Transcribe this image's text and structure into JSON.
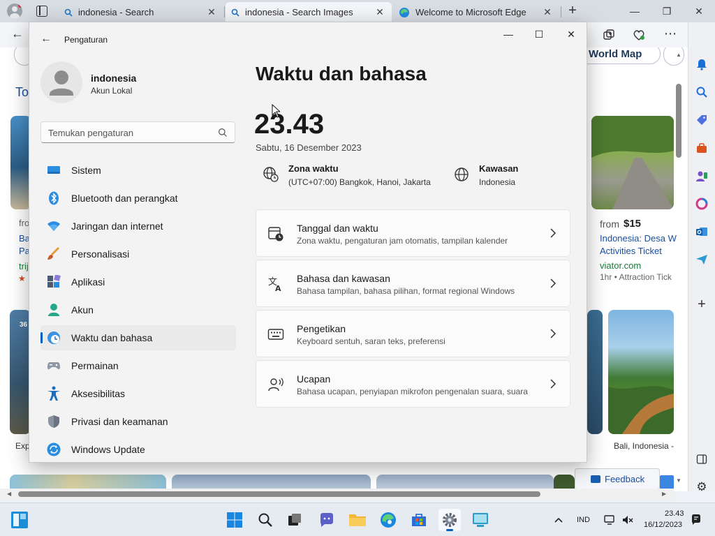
{
  "browser": {
    "tabs": [
      {
        "label": "indonesia - Search",
        "icon": "search-icon"
      },
      {
        "label": "indonesia - Search Images",
        "icon": "search-icon"
      },
      {
        "label": "Welcome to Microsoft Edge",
        "icon": "edge-icon"
      }
    ],
    "background": {
      "top_label": "To",
      "world_map_button": "World Map",
      "left_snippets": [
        "fro",
        "Ba",
        "Pa",
        "trij"
      ],
      "price_from": "from",
      "price_value": "$15",
      "result_title_1": "Indonesia: Desa W",
      "result_title_2": "Activities Ticket",
      "result_domain": "viator.com",
      "result_meta": "1hr • Attraction Tick",
      "caption_left": "Exp",
      "caption_right": "Bali, Indonesia -",
      "badge_text": "36",
      "feedback_label": "Feedback"
    }
  },
  "settings": {
    "window_title": "Pengaturan",
    "profile": {
      "name": "indonesia",
      "account_type": "Akun Lokal"
    },
    "search_placeholder": "Temukan pengaturan",
    "nav_items": [
      {
        "label": "Sistem",
        "icon": "monitor-icon"
      },
      {
        "label": "Bluetooth dan perangkat",
        "icon": "bluetooth-icon"
      },
      {
        "label": "Jaringan dan internet",
        "icon": "wifi-icon"
      },
      {
        "label": "Personalisasi",
        "icon": "brush-icon"
      },
      {
        "label": "Aplikasi",
        "icon": "apps-icon"
      },
      {
        "label": "Akun",
        "icon": "account-icon"
      },
      {
        "label": "Waktu dan bahasa",
        "icon": "clock-globe-icon",
        "selected": true
      },
      {
        "label": "Permainan",
        "icon": "gamepad-icon"
      },
      {
        "label": "Aksesibilitas",
        "icon": "accessibility-icon"
      },
      {
        "label": "Privasi dan keamanan",
        "icon": "shield-icon"
      },
      {
        "label": "Windows Update",
        "icon": "update-icon"
      }
    ],
    "page_title": "Waktu dan bahasa",
    "current_time": "23.43",
    "current_date": "Sabtu, 16 Desember 2023",
    "timezone": {
      "label": "Zona waktu",
      "value": "(UTC+07:00) Bangkok, Hanoi, Jakarta"
    },
    "region": {
      "label": "Kawasan",
      "value": "Indonesia"
    },
    "cards": [
      {
        "title": "Tanggal dan waktu",
        "subtitle": "Zona waktu, pengaturan jam otomatis, tampilan kalender",
        "icon": "calendar-clock-icon"
      },
      {
        "title": "Bahasa dan kawasan",
        "subtitle": "Bahasa tampilan, bahasa pilihan, format regional Windows",
        "icon": "language-icon"
      },
      {
        "title": "Pengetikan",
        "subtitle": "Keyboard sentuh, saran teks, preferensi",
        "icon": "keyboard-icon"
      },
      {
        "title": "Ucapan",
        "subtitle": "Bahasa ucapan, penyiapan mikrofon pengenalan suara, suara",
        "icon": "speech-icon"
      }
    ]
  },
  "taskbar": {
    "language": "IND",
    "time": "23.43",
    "date": "16/12/2023"
  },
  "colors": {
    "accent": "#005fb8",
    "edge_blue": "#0c7bd8",
    "settings_bg": "#f3f3f3"
  }
}
